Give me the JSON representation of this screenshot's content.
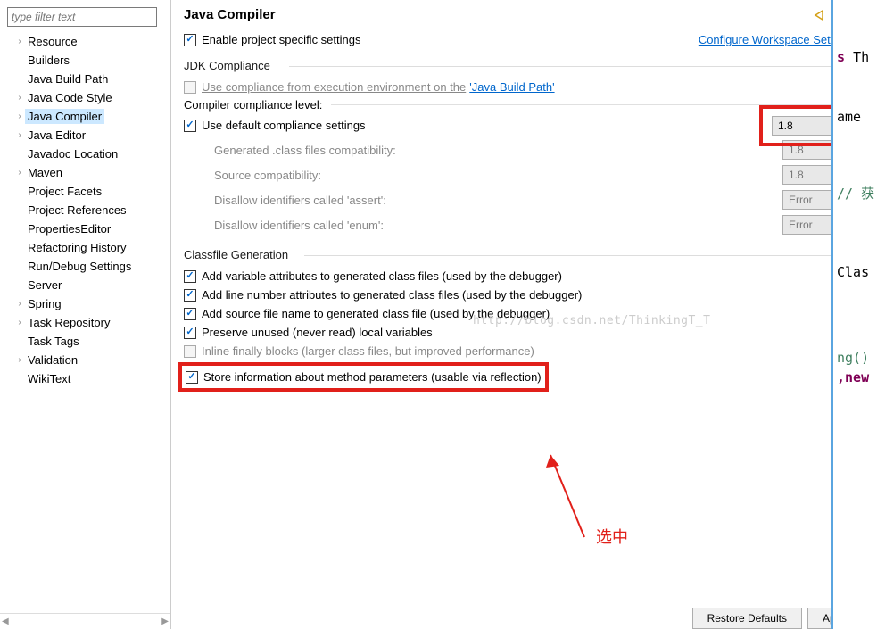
{
  "header": {
    "title": "Java Compiler"
  },
  "sidebar": {
    "filter_placeholder": "type filter text",
    "items": [
      {
        "label": "Resource",
        "expandable": true
      },
      {
        "label": "Builders",
        "expandable": false
      },
      {
        "label": "Java Build Path",
        "expandable": false
      },
      {
        "label": "Java Code Style",
        "expandable": true
      },
      {
        "label": "Java Compiler",
        "expandable": true,
        "selected": true
      },
      {
        "label": "Java Editor",
        "expandable": true
      },
      {
        "label": "Javadoc Location",
        "expandable": false
      },
      {
        "label": "Maven",
        "expandable": true
      },
      {
        "label": "Project Facets",
        "expandable": false
      },
      {
        "label": "Project References",
        "expandable": false
      },
      {
        "label": "PropertiesEditor",
        "expandable": false
      },
      {
        "label": "Refactoring History",
        "expandable": false
      },
      {
        "label": "Run/Debug Settings",
        "expandable": false
      },
      {
        "label": "Server",
        "expandable": false
      },
      {
        "label": "Spring",
        "expandable": true
      },
      {
        "label": "Task Repository",
        "expandable": true
      },
      {
        "label": "Task Tags",
        "expandable": false
      },
      {
        "label": "Validation",
        "expandable": true
      },
      {
        "label": "WikiText",
        "expandable": false
      }
    ]
  },
  "enable_specific": "Enable project specific settings",
  "configure_link": "Configure Workspace Settings...",
  "jdk": {
    "group": "JDK Compliance",
    "use_exec_env_prefix": "Use compliance from execution environment on the",
    "jbp_link": "'Java Build Path'",
    "ccl_label": "Compiler compliance level:",
    "ccl_value": "1.8",
    "use_default": "Use default compliance settings",
    "gen_class": "Generated .class files compatibility:",
    "gen_class_value": "1.8",
    "src_compat": "Source compatibility:",
    "src_compat_value": "1.8",
    "dis_assert": "Disallow identifiers called 'assert':",
    "dis_assert_value": "Error",
    "dis_enum": "Disallow identifiers called 'enum':",
    "dis_enum_value": "Error"
  },
  "classfile": {
    "group": "Classfile Generation",
    "items": [
      {
        "label": "Add variable attributes to generated class files (used by the debugger)",
        "checked": true,
        "disabled": false
      },
      {
        "label": "Add line number attributes to generated class files (used by the debugger)",
        "checked": true,
        "disabled": false
      },
      {
        "label": "Add source file name to generated class file (used by the debugger)",
        "checked": true,
        "disabled": false
      },
      {
        "label": "Preserve unused (never read) local variables",
        "checked": true,
        "disabled": false
      },
      {
        "label": "Inline finally blocks (larger class files, but improved performance)",
        "checked": false,
        "disabled": true
      },
      {
        "label": "Store information about method parameters (usable via reflection)",
        "checked": true,
        "disabled": false,
        "highlight": true
      }
    ]
  },
  "footer": {
    "restore": "Restore Defaults",
    "apply": "Apply"
  },
  "annotation": {
    "select_text": "选中"
  },
  "gutter": {
    "s": "s",
    "th": "Th",
    "ame": "ame",
    "getc": "// 获",
    "clas": "Clas",
    "ng": "ng()",
    "new": ",new"
  },
  "watermark": "http://blog.csdn.net/ThinkingT_T"
}
